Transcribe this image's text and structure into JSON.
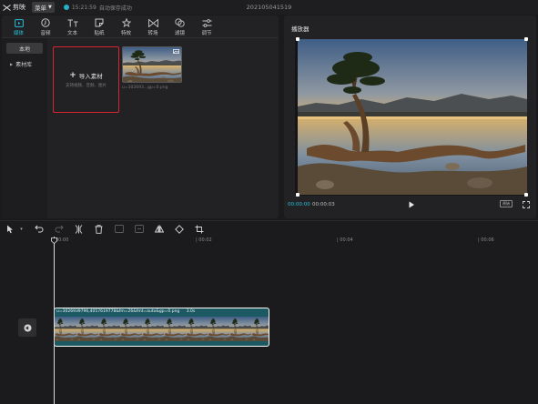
{
  "titlebar": {
    "app_name": "剪映",
    "menu_label": "菜单",
    "save_time": "15:21:59",
    "save_text": "自动保存成功",
    "project_title": "202105041519"
  },
  "toolbar": {
    "tools": [
      {
        "label": "媒体",
        "icon": "media-icon",
        "active": true
      },
      {
        "label": "音频",
        "icon": "audio-icon"
      },
      {
        "label": "文本",
        "icon": "text-icon"
      },
      {
        "label": "贴纸",
        "icon": "sticker-icon"
      },
      {
        "label": "特效",
        "icon": "effects-icon"
      },
      {
        "label": "转场",
        "icon": "transition-icon"
      },
      {
        "label": "滤镜",
        "icon": "filter-icon"
      },
      {
        "label": "调节",
        "icon": "adjust-icon"
      }
    ]
  },
  "categories": {
    "local": "本地",
    "library": "素材库"
  },
  "import": {
    "title": "导入素材",
    "subtitle": "支持视频、音频、图片"
  },
  "media": {
    "name": "u=302693...gp=0.png"
  },
  "player": {
    "title": "播放器",
    "current_time": "00:00:00",
    "total_time": "00:00:03",
    "original_label": "原始"
  },
  "timeline": {
    "ticks": [
      "00:00",
      "| 00:02",
      "| 00:04",
      "| 00:06"
    ],
    "clip_name": "u=3026939796,4057619778&fm=26&fmt=auto&gp=0.png",
    "clip_duration": "3.0s"
  },
  "colors": {
    "accent": "#28c0d6",
    "highlight_box": "#d7262e",
    "clip_fill": "#1d5962"
  }
}
